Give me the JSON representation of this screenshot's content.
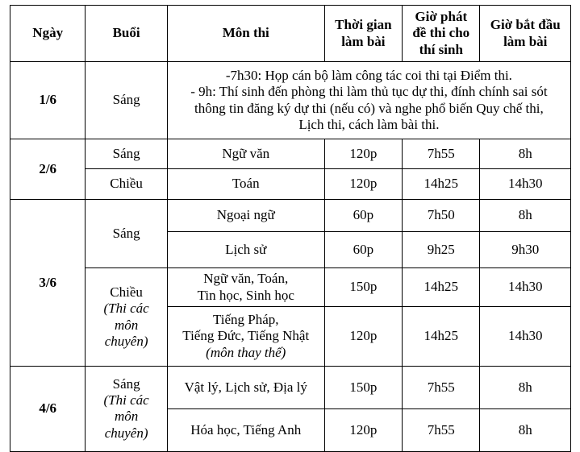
{
  "document": {
    "type": "exam-schedule-table",
    "language": "vi"
  },
  "table": {
    "headers": {
      "date": "Ngày",
      "session": "Buổi",
      "subject": "Môn thi",
      "duration": "Thời gian làm bài",
      "paper_handout_time": "Giờ phát đề thi cho thí sinh",
      "start_time": "Giờ bắt đầu làm bài"
    },
    "header_lines": {
      "duration_line1": "Thời gian",
      "duration_line2": "làm bài",
      "paper_handout_line1": "Giờ phát",
      "paper_handout_line2": "đề thi cho",
      "paper_handout_line3": "thí sinh",
      "start_line1": "Giờ bắt đầu",
      "start_line2": "làm bài"
    },
    "days": [
      {
        "date": "1/6",
        "rows": [
          {
            "session": "Sáng",
            "note_lines": [
              "-7h30: Họp cán bộ làm công tác coi thi tại Điểm thi.",
              "- 9h: Thí sinh đến phòng thi làm thủ tục dự thi, đính chính sai sót",
              "thông tin đăng ký dự thi (nếu có) và nghe phổ biến Quy chế thi,",
              "Lịch thi, cách làm bài thi."
            ]
          }
        ]
      },
      {
        "date": "2/6",
        "rows": [
          {
            "session": "Sáng",
            "subject": "Ngữ văn",
            "duration": "120p",
            "paper_handout_time": "7h55",
            "start_time": "8h"
          },
          {
            "session": "Chiều",
            "subject": "Toán",
            "duration": "120p",
            "paper_handout_time": "14h25",
            "start_time": "14h30"
          }
        ]
      },
      {
        "date": "3/6",
        "morning": {
          "session": "Sáng",
          "rows": [
            {
              "subject": "Ngoại ngữ",
              "duration": "60p",
              "paper_handout_time": "7h50",
              "start_time": "8h"
            },
            {
              "subject": "Lịch sử",
              "duration": "60p",
              "paper_handout_time": "9h25",
              "start_time": "9h30"
            }
          ]
        },
        "afternoon": {
          "session": "Chiều",
          "session_note_lines": [
            "(Thi các",
            "môn",
            "chuyên)"
          ],
          "rows": [
            {
              "subject_line1": "Ngữ văn, Toán,",
              "subject_line2": "Tin học, Sinh học",
              "duration": "150p",
              "paper_handout_time": "14h25",
              "start_time": "14h30"
            },
            {
              "subject_line1": "Tiếng Pháp,",
              "subject_line2": "Tiếng Đức, Tiếng Nhật",
              "subject_alt": "(môn thay thế)",
              "duration": "120p",
              "paper_handout_time": "14h25",
              "start_time": "14h30"
            }
          ]
        }
      },
      {
        "date": "4/6",
        "morning": {
          "session": "Sáng",
          "session_note_lines": [
            "(Thi các",
            "môn",
            "chuyên)"
          ],
          "rows": [
            {
              "subject": "Vật lý, Lịch sử, Địa lý",
              "duration": "150p",
              "paper_handout_time": "7h55",
              "start_time": "8h"
            },
            {
              "subject": "Hóa học, Tiếng Anh",
              "duration": "120p",
              "paper_handout_time": "7h55",
              "start_time": "8h"
            }
          ]
        }
      }
    ]
  },
  "colors": {
    "border": "#000000",
    "text": "#000000",
    "background": "#ffffff"
  }
}
